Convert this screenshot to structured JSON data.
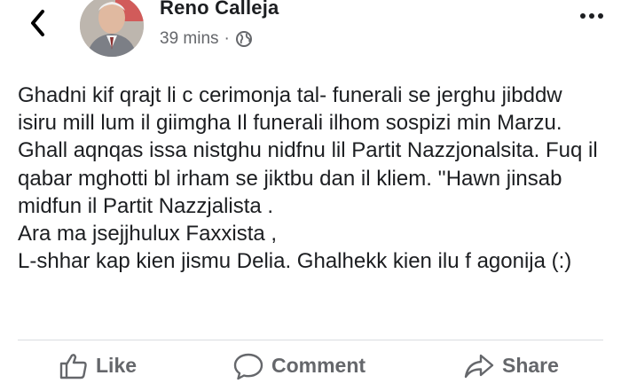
{
  "post": {
    "author": "Reno Calleja",
    "timestamp": "39 mins",
    "separator": "·",
    "privacy_icon": "globe-icon",
    "text": "Ghadni kif qrajt li c cerimonja tal- funerali se jerghu jibddw isiru mill lum il giimgha   Il funerali ilhom sospizi min Marzu. Ghall aqnqas issa nistghu nidfnu lil  Partit Nazzjonalsita. Fuq il qabar mghotti bl irham se jiktbu dan  il kliem. ''Hawn jinsab midfun il Partit Nazzjalista .\nAra ma jsejjhulux Faxxista ,\nL-shhar kap kien jismu Delia. Ghalhekk kien ilu f agonija   (:)"
  },
  "actions": {
    "like_label": "Like",
    "comment_label": "Comment",
    "share_label": "Share"
  },
  "icons": {
    "back": "chevron-left-icon",
    "more": "more-horizontal-icon",
    "like": "thumbs-up-icon",
    "comment": "speech-bubble-icon",
    "share": "share-arrow-icon"
  },
  "colors": {
    "text": "#1c1e21",
    "secondary": "#65676b",
    "divider": "#dadde1"
  }
}
